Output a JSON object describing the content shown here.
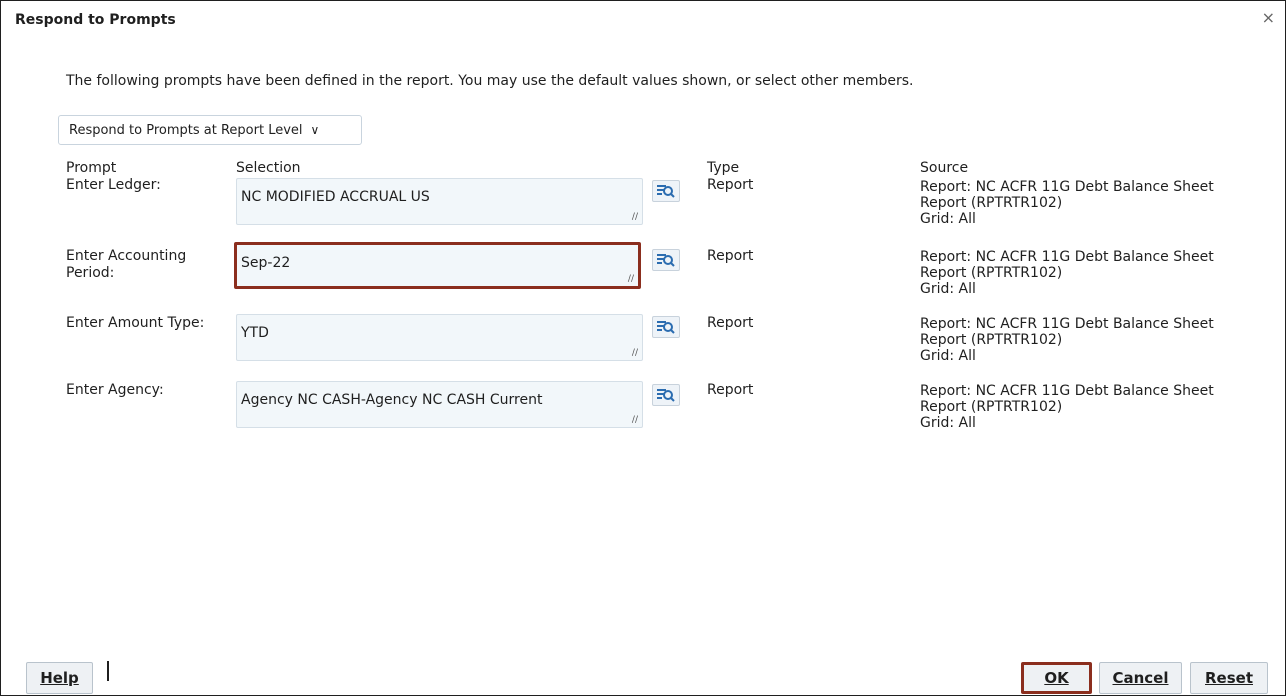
{
  "dialog": {
    "title": "Respond to Prompts",
    "close_glyph": "×",
    "intro": "The following prompts have been defined in the report. You may use the default values shown, or select other members.",
    "level_select": "Respond to Prompts at Report Level"
  },
  "table": {
    "headers": {
      "prompt": "Prompt",
      "selection": "Selection",
      "type": "Type",
      "source": "Source"
    },
    "rows": [
      {
        "prompt": "Enter Ledger:",
        "selection": "NC MODIFIED ACCRUAL US",
        "type": "Report",
        "source_line1": "Report: NC ACFR 11G Debt Balance Sheet",
        "source_line2": "Report (RPTRTR102)",
        "source_line3": "Grid: All"
      },
      {
        "prompt": "Enter Accounting Period:",
        "selection": "Sep-22",
        "type": "Report",
        "source_line1": "Report: NC ACFR 11G Debt Balance Sheet",
        "source_line2": "Report (RPTRTR102)",
        "source_line3": "Grid: All"
      },
      {
        "prompt": "Enter Amount Type:",
        "selection": "YTD",
        "type": "Report",
        "source_line1": "Report: NC ACFR 11G Debt Balance Sheet",
        "source_line2": "Report (RPTRTR102)",
        "source_line3": "Grid: All"
      },
      {
        "prompt": "Enter Agency:",
        "selection": "Agency NC CASH-Agency NC CASH Current",
        "type": "Report",
        "source_line1": "Report: NC ACFR 11G Debt Balance Sheet",
        "source_line2": "Report (RPTRTR102)",
        "source_line3": "Grid: All"
      }
    ]
  },
  "buttons": {
    "help": "Help",
    "ok": "OK",
    "cancel": "Cancel",
    "reset": "Reset"
  },
  "colors": {
    "highlight": "#8b2e1e",
    "field_bg": "#f2f7fa",
    "icon_blue": "#2b6cb0"
  },
  "icons": {
    "close": "close-icon",
    "lookup": "search-lookup-icon",
    "chevron": "chevron-down-icon",
    "resize": "resize-grip-icon"
  }
}
